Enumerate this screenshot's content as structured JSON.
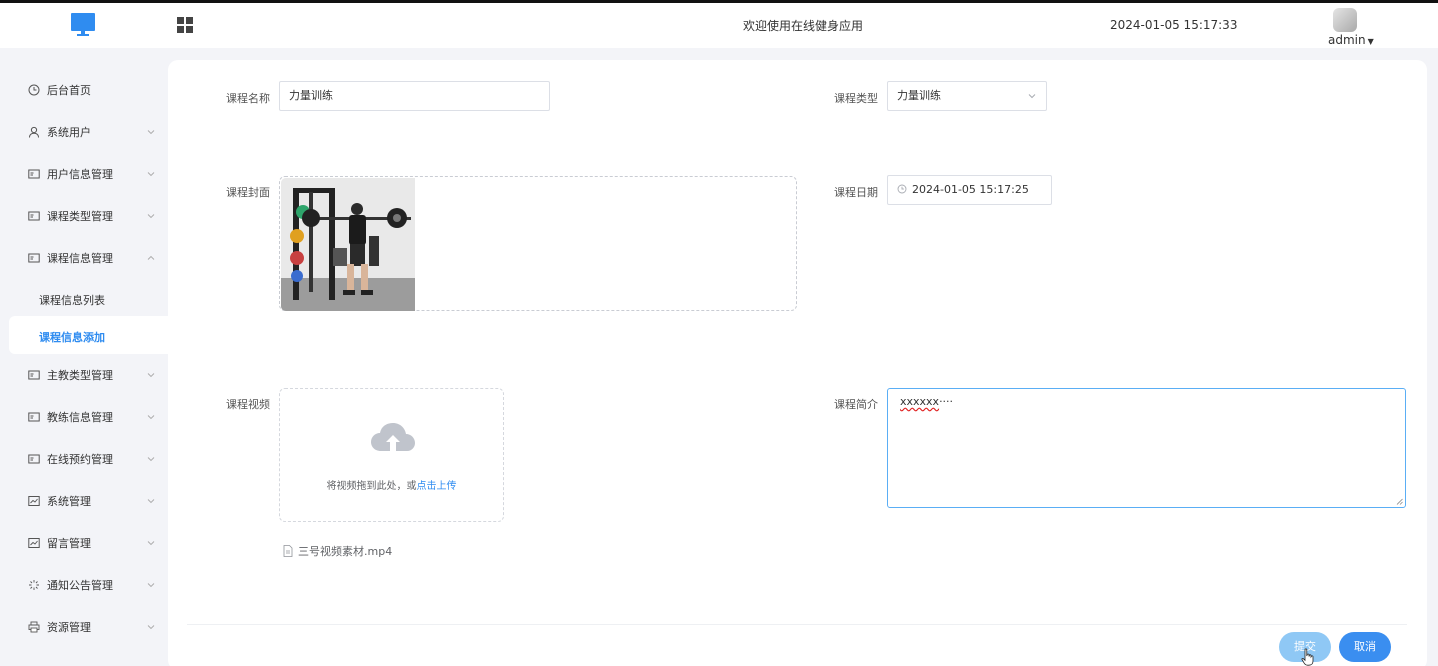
{
  "header": {
    "app_title": "欢迎使用在线健身应用",
    "datetime": "2024-01-05 15:17:33",
    "user": "admin"
  },
  "sidebar": {
    "items": [
      {
        "label": "后台首页",
        "icon": "clock-icon"
      },
      {
        "label": "系统用户",
        "icon": "user-icon"
      },
      {
        "label": "用户信息管理",
        "icon": "card-icon"
      },
      {
        "label": "课程类型管理",
        "icon": "card-icon"
      },
      {
        "label": "课程信息管理",
        "icon": "card-icon"
      },
      {
        "label": "主教类型管理",
        "icon": "card-icon"
      },
      {
        "label": "教练信息管理",
        "icon": "card-icon"
      },
      {
        "label": "在线预约管理",
        "icon": "card-icon"
      },
      {
        "label": "系统管理",
        "icon": "chart-icon"
      },
      {
        "label": "留言管理",
        "icon": "chart-icon"
      },
      {
        "label": "通知公告管理",
        "icon": "spark-icon"
      },
      {
        "label": "资源管理",
        "icon": "printer-icon"
      }
    ],
    "sub_items": [
      "课程信息列表",
      "课程信息添加"
    ]
  },
  "form": {
    "name_label": "课程名称",
    "name_value": "力量训练",
    "type_label": "课程类型",
    "type_value": "力量训练",
    "cover_label": "课程封面",
    "date_label": "课程日期",
    "date_value": "2024-01-05 15:17:25",
    "video_label": "课程视频",
    "upload_text": "将视频拖到此处，或",
    "upload_link": "点击上传",
    "file_name": "三号视频素材.mp4",
    "intro_label": "课程简介",
    "intro_spell": "xxxxxx",
    "intro_rest": "····",
    "submit": "提交",
    "cancel": "取消"
  },
  "colors": {
    "accent": "#2f8cf0",
    "submit_bg": "#8fc8f5",
    "cancel_bg": "#3a8ef0"
  }
}
